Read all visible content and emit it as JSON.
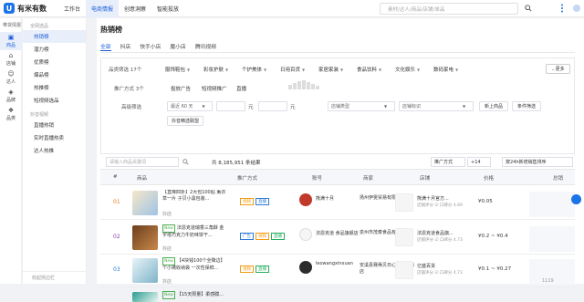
{
  "brand": {
    "name": "有米有数",
    "mark": "U"
  },
  "topnav": [
    "工作台",
    "电商情报",
    "创意洞察",
    "智能投放"
  ],
  "topnav_active": 1,
  "search": {
    "placeholder": "素材/达人/商品/店铺/单品"
  },
  "sidebar": {
    "header": "带货情报",
    "items": [
      {
        "label": "商品",
        "icon": "box-icon",
        "glyph": "▣"
      },
      {
        "label": "店铺",
        "icon": "store-icon",
        "glyph": "⌂"
      },
      {
        "label": "达人",
        "icon": "user-icon",
        "glyph": "☺"
      },
      {
        "label": "品牌",
        "icon": "brand-icon",
        "glyph": "◈"
      },
      {
        "label": "品类",
        "icon": "category-icon",
        "glyph": "❖"
      }
    ]
  },
  "subnav": {
    "groups": [
      {
        "label": "全网选品",
        "items": [
          "热销榜",
          "潜力榜",
          "优质榜",
          "爆品榜",
          "热推榜",
          "短视频选品"
        ]
      },
      {
        "label": "抖音视频",
        "items": [
          "直播热销",
          "实时直播热卖",
          "达人热推"
        ]
      }
    ],
    "footer": "收起侧边栏"
  },
  "page": {
    "title": "热销榜"
  },
  "tabs": [
    "全部",
    "抖店",
    "快手小店",
    "魔小店",
    "腾讯视频"
  ],
  "filters": {
    "category_label": "品类筛选 17个",
    "categories": [
      "服饰鞋包",
      "彩妆护肤",
      "个护美体",
      "日用百货",
      "家居家装",
      "食品饮料",
      "文化娱乐",
      "数码家电"
    ],
    "more": "更多",
    "promo_label": "推广方式 3个",
    "promos": [
      "投放广告",
      "短视频推广",
      "直播"
    ],
    "advanced_label": "高级筛选",
    "period": "最近 60 天",
    "range_unit_1": "元",
    "range_unit_2": "元",
    "shop_type": "店铺类型",
    "shop_tag": "店铺标识",
    "btn_new": "新上商品",
    "btn_filter": "条件筛选",
    "btn_link": "抖音精选联盟"
  },
  "toolbar": {
    "keyword_placeholder": "请输入商品关键词",
    "count_text": "共 8,185,951 条结果",
    "sort_mode": "推广方式",
    "sort_extra": "+14",
    "sort_order": "按24h新增销售排序"
  },
  "table": {
    "headers": [
      "#",
      "商品",
      "推广方式",
      "账号",
      "商家",
      "店铺",
      "价格",
      "总销"
    ],
    "rows": [
      {
        "rank": "01",
        "is_new": false,
        "tag": "【直降四折】",
        "name": "2大包100贴 薰衣草一片 子贝小黑包装...",
        "shop": "抖店",
        "modes": [
          "视频",
          "直播"
        ],
        "account": "熊满十月",
        "merchant": "扬州伊雯贸易有限公司",
        "shop_name": "熊满十月官方...",
        "shop_score": "店铺评分 ☑ 口碑分 4.69",
        "price": "¥0.05"
      },
      {
        "rank": "02",
        "is_new": true,
        "tag": "",
        "name": "法恩克道瑞香三角酥 金字塔巧克力牛奶味饼干...",
        "shop": "抖店",
        "modes": [
          "广告",
          "视频",
          "直播"
        ],
        "account": "法恩克道 食品旗舰店",
        "merchant": "泉州市茂泰食品有限公司",
        "shop_name": "法恩克道食品旗...",
        "shop_score": "店铺评分 ☑ 口碑分 4.73",
        "price": "¥0.2 ~ ¥0.4"
      },
      {
        "rank": "03",
        "is_new": true,
        "tag": "【4块钱100个全降边】",
        "name": "个小烤收纳袋 一次性保鲜...",
        "shop": "抖店",
        "modes": [
          "视频",
          "直播"
        ],
        "account": "leowangxinxuan",
        "merchant": "安溪县赛舜贝日心选外贸商店",
        "shop_name": "亿盛百货",
        "shop_score": "店铺评分 ☑ 口碑分 4.73",
        "price": "¥0.1 ~ ¥0.27"
      },
      {
        "rank": "",
        "is_new": true,
        "tag": "【15天限量】",
        "name": "柔感膜...",
        "shop": "",
        "modes": [],
        "account": "",
        "merchant": "",
        "shop_name": "",
        "shop_score": "",
        "price": ""
      }
    ]
  },
  "colors": {
    "accent": "#1a5cd8",
    "rank": "#e67e22",
    "tag_orange": "#f39c12",
    "tag_green": "#27ae60",
    "tag_blue": "#2e7bd6"
  },
  "footer_fragment": "1119"
}
